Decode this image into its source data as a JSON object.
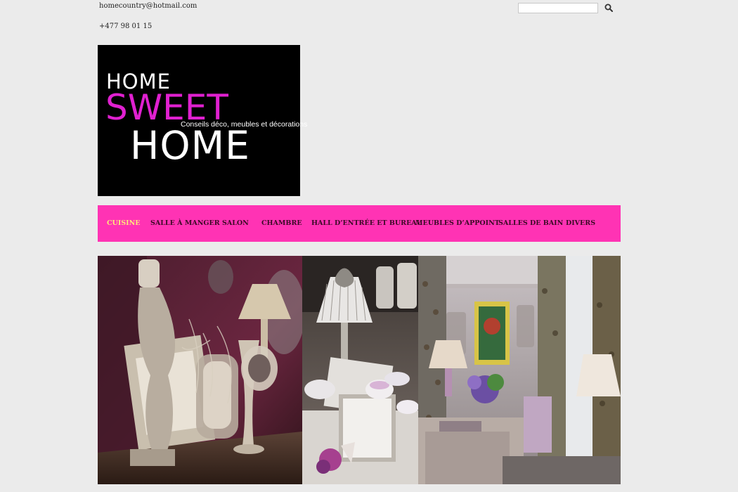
{
  "contact": {
    "email": "homecountry@hotmail.com",
    "phone": "+477 98 01 15"
  },
  "search": {
    "placeholder": "",
    "value": "",
    "icon": "search-icon"
  },
  "logo": {
    "line1": "HOME",
    "line2": "SWEET",
    "tagline": "Conseils déco, meubles et décorations",
    "line3": "HOME",
    "colors": {
      "background": "#000000",
      "sweet": "#e020d0",
      "text": "#ffffff"
    }
  },
  "nav": {
    "items": [
      {
        "label": "CUISINE",
        "active": true
      },
      {
        "label": "SALLE À MANGER",
        "active": false
      },
      {
        "label": "SALON",
        "active": false
      },
      {
        "label": "CHAMBRE",
        "active": false
      },
      {
        "label": "HALL D’ENTRÉE ET BUREAU",
        "active": false
      },
      {
        "label": "MEUBLES D’APPOINT",
        "active": false
      },
      {
        "label": "SALLES DE BAIN",
        "active": false
      },
      {
        "label": "DIVERS",
        "active": false
      }
    ],
    "colors": {
      "background": "#ff33b4",
      "active": "#ffe67a",
      "text": "#3a0a25"
    }
  },
  "gallery": {
    "images": [
      "photo-interior-vintage-frames",
      "photo-interior-lamp-cups",
      "photo-interior-living-room"
    ]
  }
}
